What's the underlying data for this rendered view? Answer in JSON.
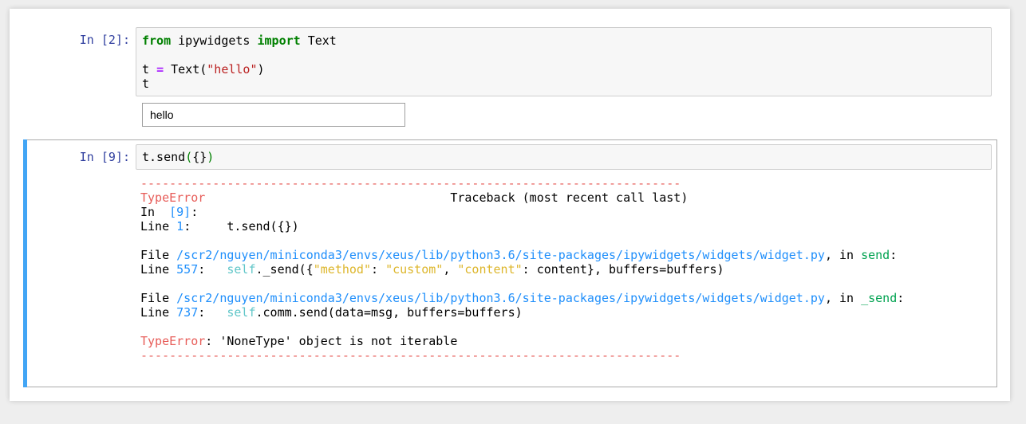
{
  "cell1": {
    "prompt": "In [2]:",
    "code": {
      "l1_kw1": "from",
      "l1_mod": " ipywidgets ",
      "l1_kw2": "import",
      "l1_name": " Text",
      "l3_var": "t ",
      "l3_op": "=",
      "l3_call": " Text(",
      "l3_str": "\"hello\"",
      "l3_close": ")",
      "l4": "t"
    },
    "widget_value": "hello"
  },
  "cell2": {
    "prompt": "In [9]:",
    "code": {
      "pre": "t.send",
      "open": "(",
      "args": "{}",
      "close": ")"
    },
    "traceback": {
      "dashes": "---------------------------------------------------------------------------",
      "error_name": "TypeError",
      "header_right": "Traceback (most recent call last)",
      "in_label": "In  ",
      "in_num": "[9]",
      "in_colon": ":",
      "line1_label": "Line ",
      "line1_num": "1",
      "line1_rest": ":     t.send({})",
      "file1_label": "File ",
      "file1_path": "/scr2/nguyen/miniconda3/envs/xeus/lib/python3.6/site-packages/ipywidgets/widgets/widget.py",
      "file1_in": ", in ",
      "file1_func": "send",
      "file1_colon": ":",
      "line2_label": "Line ",
      "line2_num": "557",
      "line2_colon": ":   ",
      "line2_self": "self",
      "line2_a": "._send({",
      "line2_s1": "\"method\"",
      "line2_b": ": ",
      "line2_s2": "\"custom\"",
      "line2_c": ", ",
      "line2_s3": "\"content\"",
      "line2_d": ": content}, buffers=buffers)",
      "file2_label": "File ",
      "file2_path": "/scr2/nguyen/miniconda3/envs/xeus/lib/python3.6/site-packages/ipywidgets/widgets/widget.py",
      "file2_in": ", in ",
      "file2_func": "_send",
      "file2_colon": ":",
      "line3_label": "Line ",
      "line3_num": "737",
      "line3_colon": ":   ",
      "line3_self": "self",
      "line3_rest": ".comm.send(data=msg, buffers=buffers)",
      "err_msg": ": 'NoneType' object is not iterable"
    }
  },
  "colors": {
    "prompt": "#303f9f",
    "selected_bar": "#42a5f5",
    "error_red": "#e75c58"
  }
}
